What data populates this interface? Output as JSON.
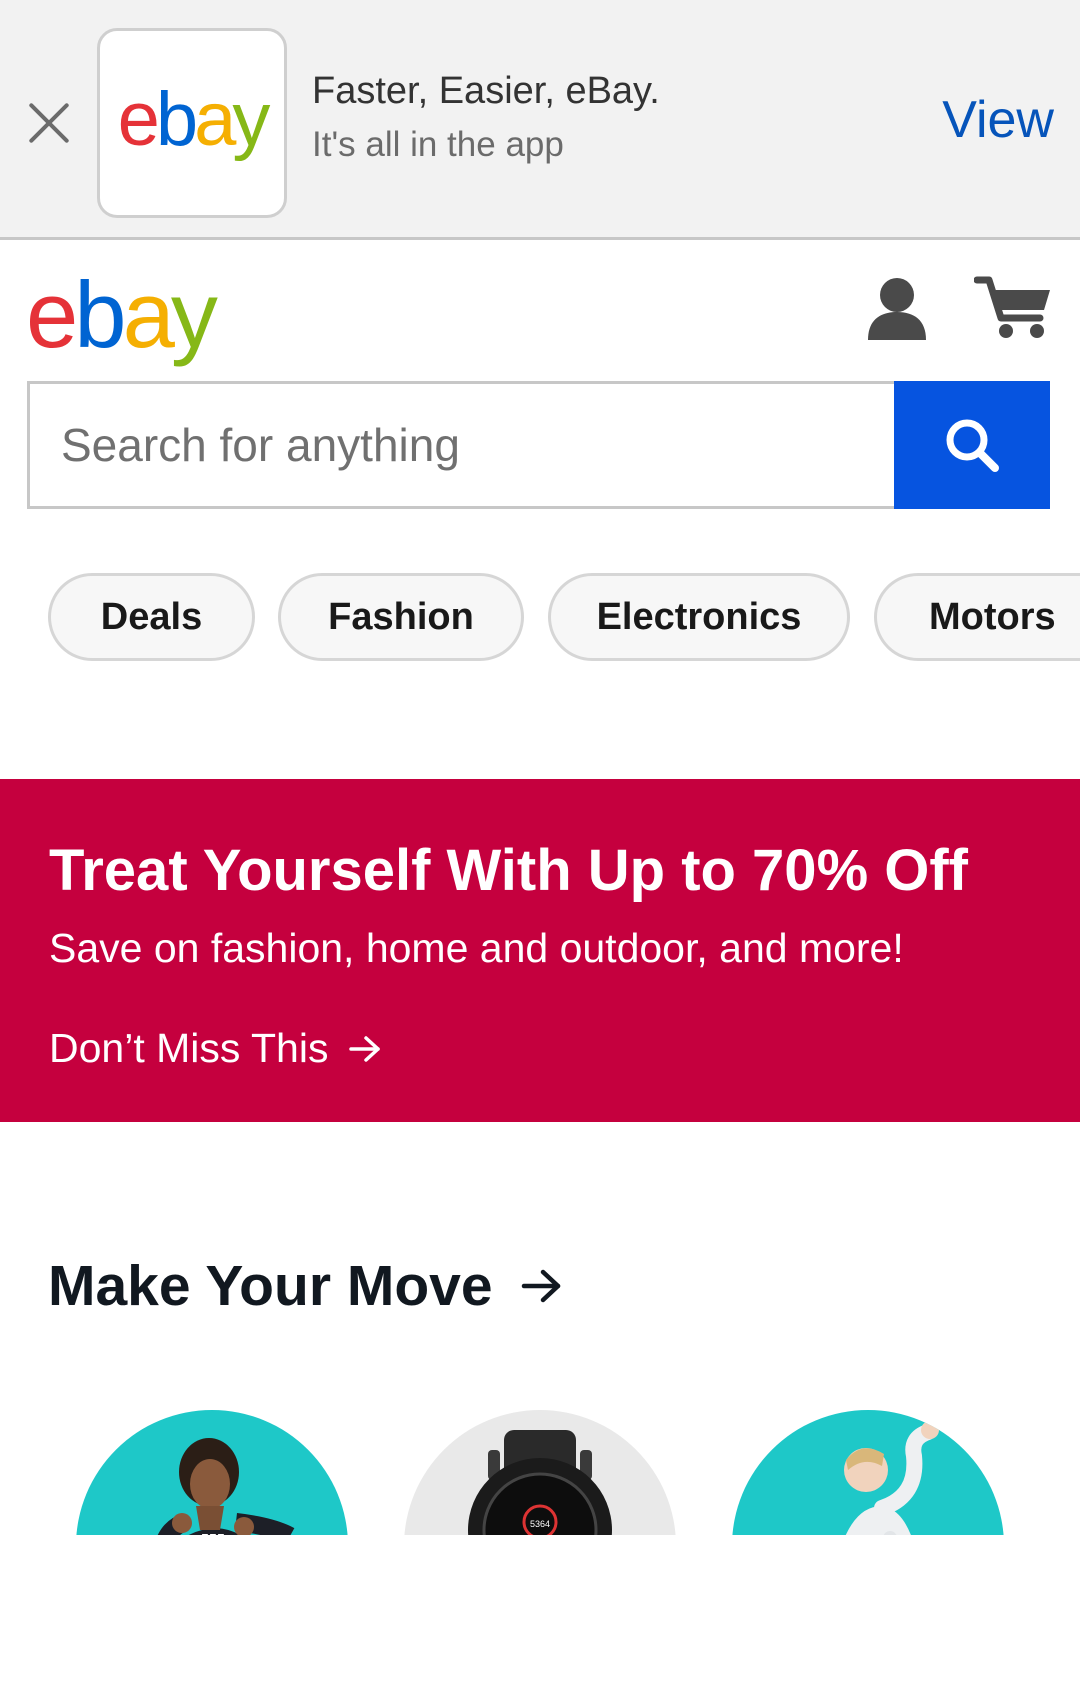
{
  "app_banner": {
    "close_icon": "close-icon",
    "logo_text": [
      "e",
      "b",
      "a",
      "y"
    ],
    "title": "Faster, Easier, eBay.",
    "subtitle": "It's all in the app",
    "view_label": "View"
  },
  "header": {
    "logo_text": [
      "e",
      "b",
      "a",
      "y"
    ],
    "account_icon": "user-icon",
    "cart_icon": "cart-icon"
  },
  "search": {
    "placeholder": "Search for anything",
    "value": "",
    "button_icon": "search-icon"
  },
  "categories": [
    "Deals",
    "Fashion",
    "Electronics",
    "Motors"
  ],
  "promo": {
    "title": "Treat Yourself With Up to 70% Off",
    "subtitle": "Save on fashion, home and outdoor, and more!",
    "link_label": "Don’t Miss This",
    "background": "#c5003e"
  },
  "section": {
    "title": "Make Your Move",
    "tiles": [
      {
        "subject": "person in jacket",
        "background": "#1ec8c8"
      },
      {
        "subject": "smart watch",
        "background": "#e9e9e9",
        "watch_readout": "5364"
      },
      {
        "subject": "athlete stretching",
        "background": "#1ec8c8"
      }
    ]
  },
  "colors": {
    "brand_red": "#e53238",
    "brand_blue": "#0064d2",
    "brand_yellow": "#f5af02",
    "brand_green": "#86b817",
    "search_button": "#0654e0",
    "link_blue": "#0654ba"
  }
}
